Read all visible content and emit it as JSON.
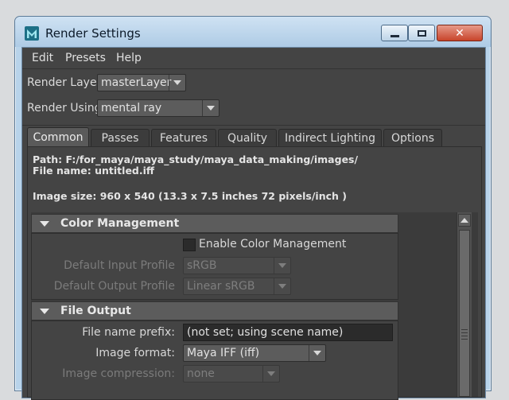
{
  "window": {
    "title": "Render Settings",
    "close_glyph": "✕"
  },
  "menu": [
    "Edit",
    "Presets",
    "Help"
  ],
  "render_layer": {
    "label": "Render Layer",
    "value": "masterLayer"
  },
  "render_using": {
    "label": "Render Using",
    "value": "mental ray"
  },
  "tabs": [
    {
      "label": "Common",
      "active": true
    },
    {
      "label": "Passes"
    },
    {
      "label": "Features"
    },
    {
      "label": "Quality"
    },
    {
      "label": "Indirect Lighting"
    },
    {
      "label": "Options"
    }
  ],
  "info": {
    "path": "Path: F:/for_maya/maya_study/maya_data_making/images/",
    "file_name": "File name:  untitled.iff",
    "image_size": "Image size: 960 x 540 (13.3 x 7.5 inches 72 pixels/inch )"
  },
  "color_management": {
    "title": "Color Management",
    "enable_label": "Enable Color Management",
    "input_profile_label": "Default Input Profile",
    "input_profile_value": "sRGB",
    "output_profile_label": "Default Output Profile",
    "output_profile_value": "Linear sRGB"
  },
  "file_output": {
    "title": "File Output",
    "prefix_label": "File name prefix:",
    "prefix_value": "(not set; using scene name)",
    "format_label": "Image format:",
    "format_value": "Maya IFF (iff)",
    "compression_label": "Image compression:",
    "compression_value": "none"
  },
  "colors": {
    "panel": "#444444",
    "titlebar": "#b8d3ea",
    "close_button": "#c8442a"
  },
  "icons": [
    "maya-app-icon",
    "minimize-icon",
    "maximize-icon",
    "close-icon",
    "dropdown-arrow-icon",
    "collapse-triangle-icon",
    "scroll-up-icon"
  ]
}
